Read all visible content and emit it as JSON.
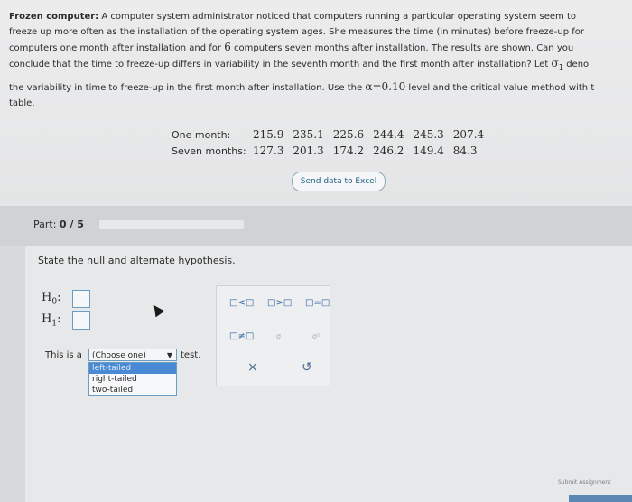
{
  "problem": {
    "title": "Frozen computer:",
    "line1": "A computer system administrator noticed that computers running a particular operating system seem to",
    "line2a": "freeze up more often as the installation of the operating system ages. She measures the time (in minutes) before freeze-up for",
    "line3a": "computers one month after installation and for",
    "line3num": "6",
    "line3b": "computers seven months after installation. The results are shown. Can you",
    "line4a": "conclude that the time to freeze-up differs in variability in the seventh month and the first month after installation? Let",
    "line4sym": "σ",
    "line4sub": "1",
    "line4b": "deno",
    "line5a": "the variability in time to freeze-up in the first month after installation. Use the",
    "line5alpha": "α=0.10",
    "line5b": "level and the critical value method with t",
    "line6": "table."
  },
  "table": {
    "rows": [
      {
        "label": "One month:",
        "values": [
          "215.9",
          "235.1",
          "225.6",
          "244.4",
          "245.3",
          "207.4"
        ]
      },
      {
        "label": "Seven months:",
        "values": [
          "127.3",
          "201.3",
          "174.2",
          "246.2",
          "149.4",
          "84.3"
        ]
      }
    ]
  },
  "send_button": "Send data to Excel",
  "part": {
    "prefix": "Part:",
    "value": "0 / 5"
  },
  "instruction": "State the null and alternate hypothesis.",
  "hyp": {
    "h0": "H",
    "h0sub": "0",
    "h1": "H",
    "h1sub": "1",
    "colon": ":"
  },
  "palette": {
    "lt": "□<□",
    "gt": "□>□",
    "eq": "□=□",
    "ne": "□≠□",
    "g1": "σ",
    "g2": "σ²",
    "clear": "×",
    "undo": "↺"
  },
  "test_prefix": "This is a",
  "test_select": "(Choose one)",
  "test_suffix": "test.",
  "options": [
    "left-tailed",
    "right-tailed",
    "two-tailed"
  ],
  "submit": "Submit Assignment",
  "colors": {
    "accent": "#4a8ad4",
    "link": "#1f5f84"
  }
}
